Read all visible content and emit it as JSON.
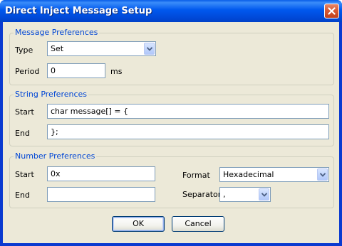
{
  "window": {
    "title": "Direct Inject Message Setup"
  },
  "message_prefs": {
    "legend": "Message Preferences",
    "type_label": "Type",
    "type_value": "Set",
    "period_label": "Period",
    "period_value": "0",
    "period_unit": "ms"
  },
  "string_prefs": {
    "legend": "String Preferences",
    "start_label": "Start",
    "start_value": "char message[] = {",
    "end_label": "End",
    "end_value": "};"
  },
  "number_prefs": {
    "legend": "Number Preferences",
    "start_label": "Start",
    "start_value": "0x",
    "end_label": "End",
    "end_value": "",
    "format_label": "Format",
    "format_value": "Hexadecimal",
    "separator_label": "Separator",
    "separator_value": ","
  },
  "buttons": {
    "ok": "OK",
    "cancel": "Cancel"
  },
  "icons": {
    "close": "close-icon",
    "dropdown": "chevron-down-icon"
  },
  "colors": {
    "title_bar": "#0054e3",
    "legend_text": "#0046d5",
    "dialog_bg": "#ece9d8",
    "close_button": "#d85a34"
  }
}
